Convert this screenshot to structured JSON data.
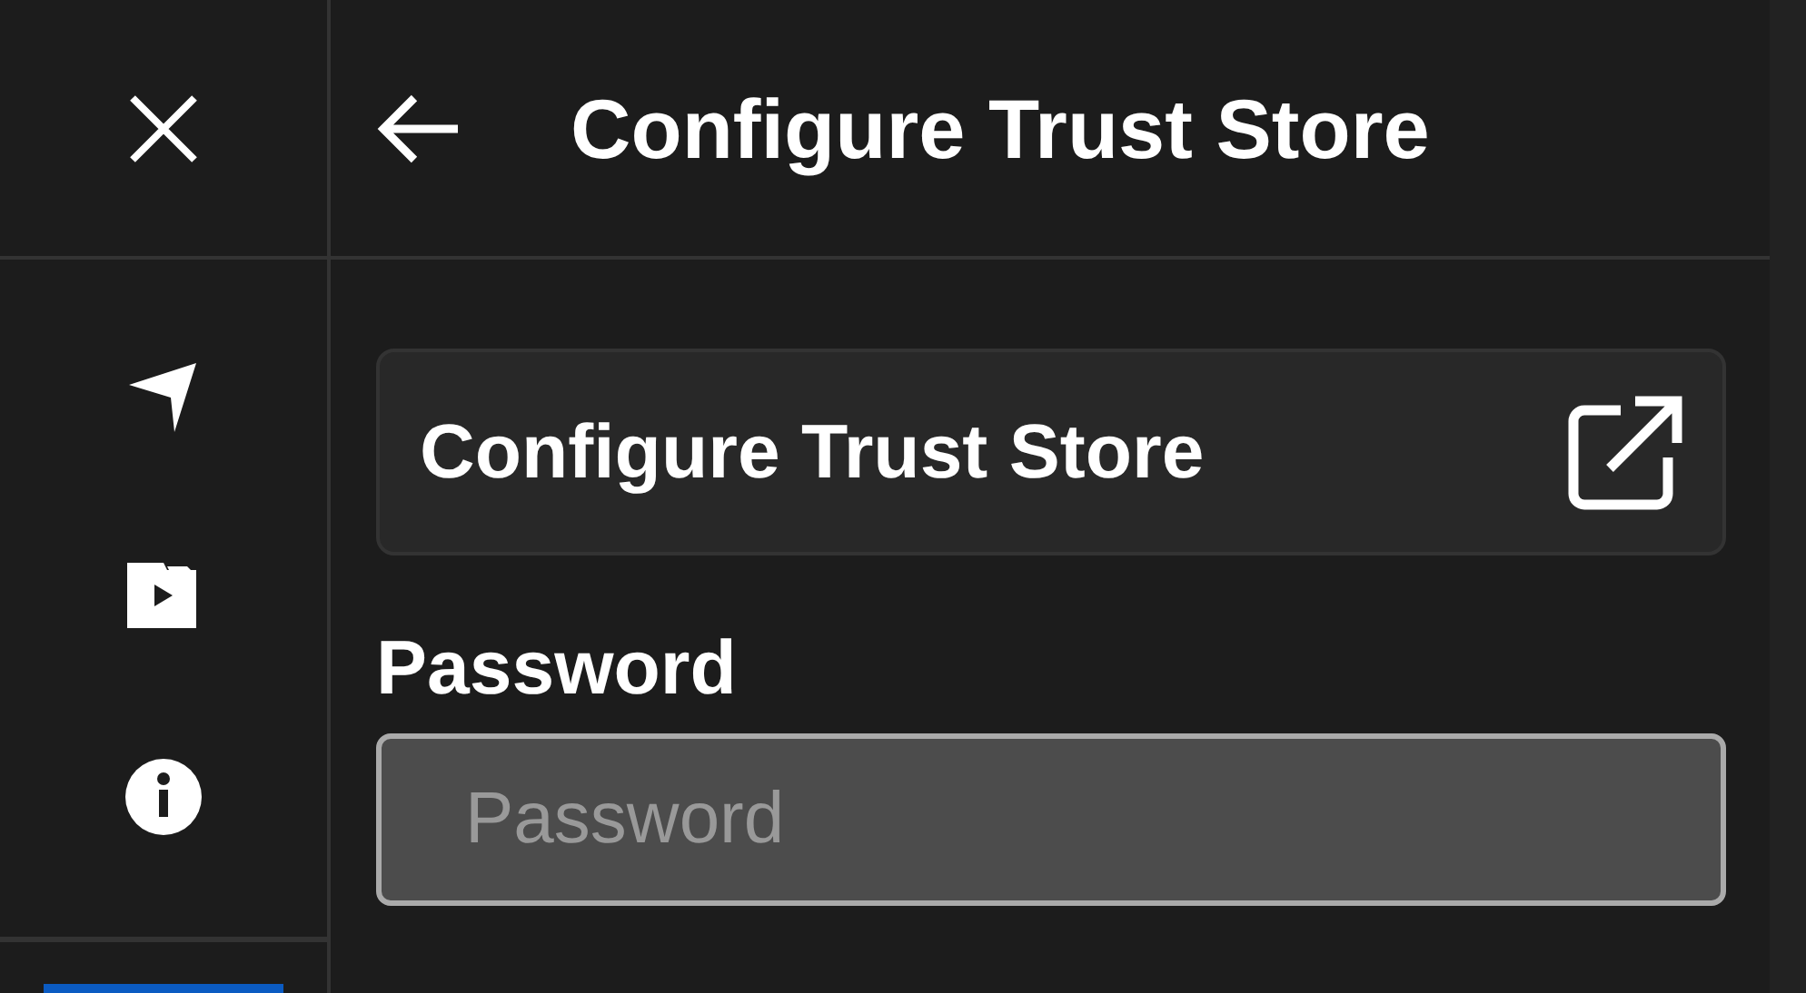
{
  "header": {
    "title": "Configure Trust Store"
  },
  "sidebar": {
    "items": [
      {
        "kind": "navigate"
      },
      {
        "kind": "media"
      },
      {
        "kind": "info"
      }
    ]
  },
  "link_button": {
    "label": "Configure Trust Store"
  },
  "password": {
    "label": "Password",
    "placeholder": "Password"
  }
}
